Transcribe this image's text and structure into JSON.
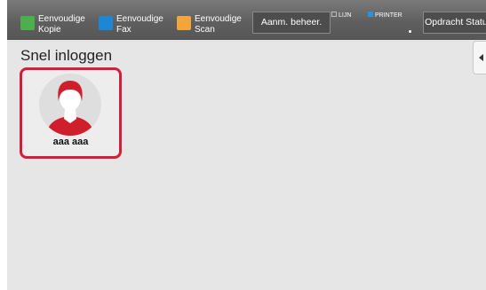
{
  "header": {
    "shortcuts": [
      {
        "label": "Eenvoudige\nKopie",
        "icon": "copy-icon",
        "color": "#4cae4c"
      },
      {
        "label": "Eenvoudige\nFax",
        "icon": "fax-icon",
        "color": "#1d87d4"
      },
      {
        "label": "Eenvoudige\nScan",
        "icon": "scan-icon",
        "color": "#f2a53c"
      }
    ],
    "admin_button": "Aanm. beheer.",
    "indicators": {
      "line": "LIJN",
      "printer": "PRINTER"
    },
    "status_button": "Opdracht Status"
  },
  "main": {
    "title": "Snel inloggen",
    "users": [
      {
        "name": "aaa aaa",
        "avatar": "user-avatar-icon"
      }
    ],
    "selection_color": "#d31f3a",
    "side_tab_icon": "chevron-left-icon"
  }
}
